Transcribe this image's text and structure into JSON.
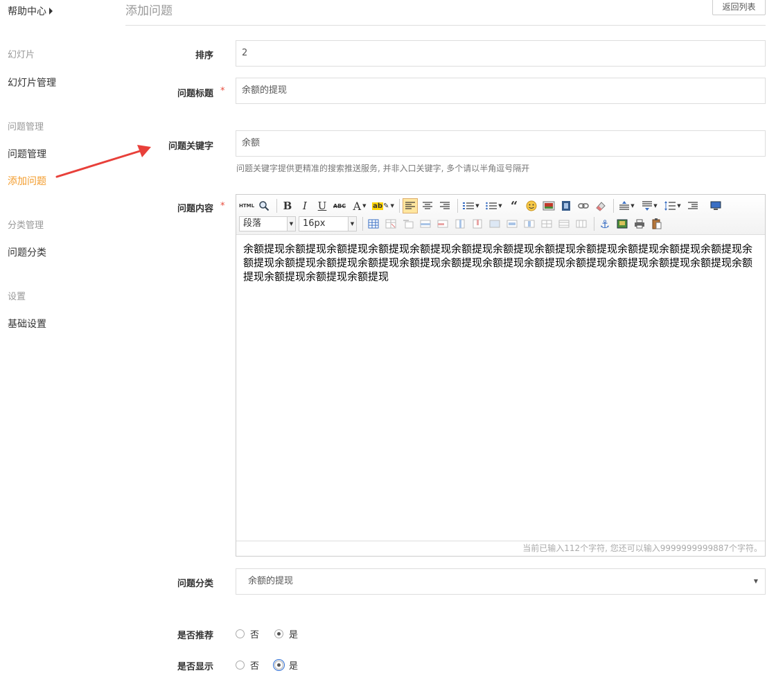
{
  "sidebar": {
    "help_center": "帮助中心",
    "sections": [
      {
        "title": "幻灯片",
        "items": [
          "幻灯片管理"
        ]
      },
      {
        "title": "问题管理",
        "items": [
          "问题管理",
          "添加问题"
        ]
      },
      {
        "title": "分类管理",
        "items": [
          "问题分类"
        ]
      },
      {
        "title": "设置",
        "items": [
          "基础设置"
        ]
      }
    ],
    "active_item": "添加问题"
  },
  "header": {
    "title": "添加问题",
    "back_button": "返回列表"
  },
  "form": {
    "sort": {
      "label": "排序",
      "value": "2"
    },
    "title": {
      "label": "问题标题",
      "required": "*",
      "value": "余额的提现"
    },
    "keywords": {
      "label": "问题关键字",
      "value": "余额",
      "hint": "问题关键字提供更精准的搜索推送服务, 并非入口关键字, 多个请以半角逗号隔开"
    },
    "content": {
      "label": "问题内容",
      "required": "*",
      "paragraph_select": "段落",
      "font_size_select": "16px",
      "text": "余额提现余额提现余额提现余额提现余额提现余额提现余额提现余额提现余额提现余额提现余额提现余额提现余额提现余额提现余额提现余额提现余额提现余额提现余额提现余额提现余额提现余额提现余额提现余额提现余额提现余额提现余额提现余额提现",
      "status": "当前已输入112个字符, 您还可以输入9999999999887个字符。"
    },
    "category": {
      "label": "问题分类",
      "value": "余额的提现"
    },
    "recommend": {
      "label": "是否推荐",
      "options": [
        "否",
        "是"
      ],
      "selected": "是"
    },
    "display": {
      "label": "是否显示",
      "options": [
        "否",
        "是"
      ],
      "selected": "是"
    }
  },
  "colors": {
    "accent": "#f39c2c",
    "required": "#e84c3d",
    "annotation_arrow": "#e8403a"
  }
}
